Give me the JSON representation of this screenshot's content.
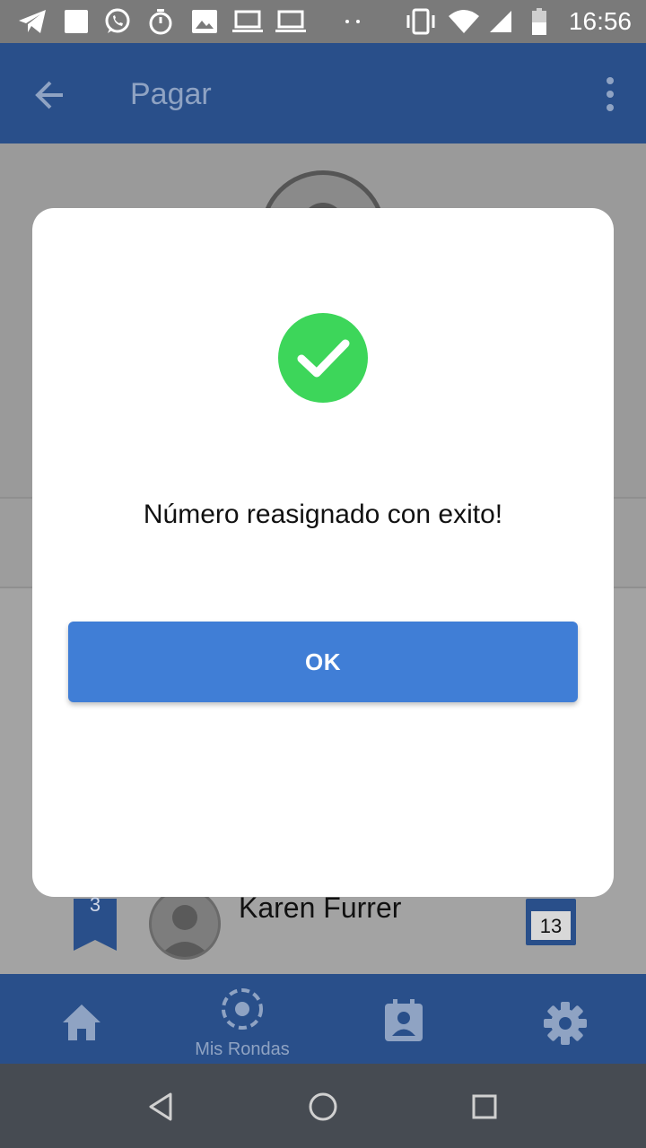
{
  "status_bar": {
    "time": "16:56",
    "icons": [
      "telegram-icon",
      "square-icon",
      "whatsapp-icon",
      "stopwatch-icon",
      "image-icon",
      "laptop-icon",
      "laptop-icon",
      "dots-icon",
      "vibrate-icon",
      "wifi-icon",
      "signal-icon",
      "battery-icon"
    ]
  },
  "app_bar": {
    "title": "Pagar",
    "back_icon": "arrow-back-icon",
    "menu_icon": "more-vert-icon"
  },
  "background_list": {
    "rank": "3",
    "name": "Karen Furrer",
    "day": "13"
  },
  "dialog": {
    "icon": "check-circle-icon",
    "message": "Número reasignado con exito!",
    "ok_label": "OK"
  },
  "bottom_nav": {
    "items": [
      {
        "icon": "home-icon",
        "label": ""
      },
      {
        "icon": "rounds-icon",
        "label": "Mis Rondas"
      },
      {
        "icon": "contact-calendar-icon",
        "label": ""
      },
      {
        "icon": "settings-icon",
        "label": ""
      }
    ]
  },
  "colors": {
    "app_bar": "#294f8a",
    "accent_button": "#407ed6",
    "success_green": "#3dd65a",
    "system_nav": "#464b52"
  }
}
